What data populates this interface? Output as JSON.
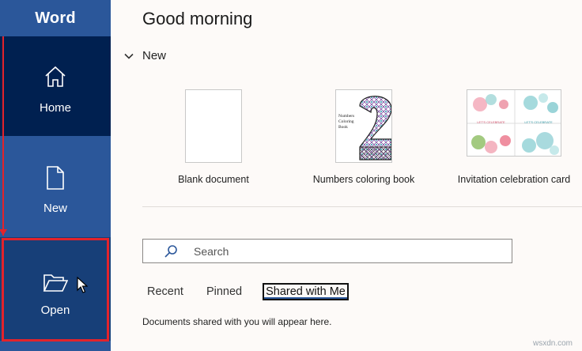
{
  "app": {
    "title": "Word"
  },
  "sidebar": {
    "items": [
      {
        "label": "Home",
        "icon": "home-icon"
      },
      {
        "label": "New",
        "icon": "new-document-icon"
      },
      {
        "label": "Open",
        "icon": "folder-open-icon"
      }
    ]
  },
  "colors": {
    "sidebar": "#2b579a",
    "sidebar_active": "#002050",
    "sidebar_open": "#173f78",
    "annotation": "#e3232b"
  },
  "main": {
    "greeting": "Good morning",
    "new_section": {
      "label": "New",
      "templates": [
        {
          "name": "Blank document"
        },
        {
          "name": "Numbers coloring book",
          "thumb_text": [
            "Numbers",
            "Coloring",
            "Book"
          ]
        },
        {
          "name": "Invitation celebration card",
          "thumb_text": "LET'S CELEBRATE"
        }
      ]
    },
    "search": {
      "placeholder": "Search",
      "value": ""
    },
    "tabs": [
      {
        "label": "Recent"
      },
      {
        "label": "Pinned"
      },
      {
        "label": "Shared with Me"
      }
    ],
    "active_tab": "Shared with Me",
    "empty_message": "Documents shared with you will appear here."
  },
  "watermark": "wsxdn.com"
}
